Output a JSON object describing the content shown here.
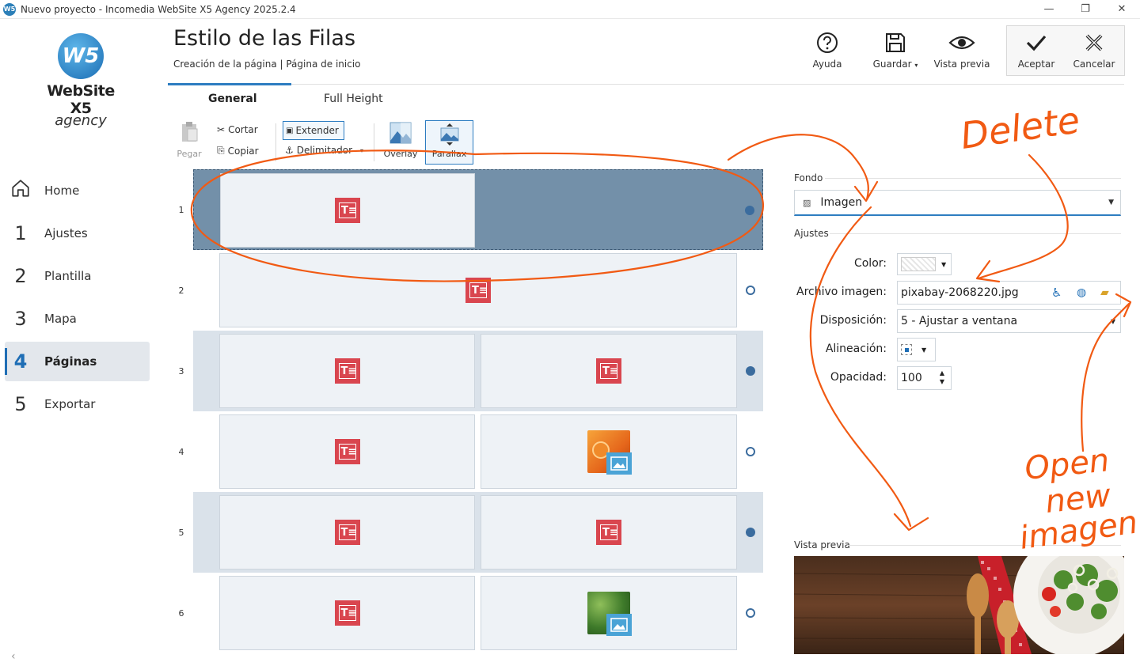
{
  "window": {
    "title": "Nuevo proyecto - Incomedia WebSite X5 Agency 2025.2.4",
    "minimize": "—",
    "maximize": "❐",
    "close": "✕"
  },
  "logo": {
    "line1": "WebSite X5",
    "line2": "agency",
    "mark": "W5"
  },
  "sidebar": {
    "items": [
      {
        "num": "",
        "label": "Home"
      },
      {
        "num": "1",
        "label": "Ajustes"
      },
      {
        "num": "2",
        "label": "Plantilla"
      },
      {
        "num": "3",
        "label": "Mapa"
      },
      {
        "num": "4",
        "label": "Páginas"
      },
      {
        "num": "5",
        "label": "Exportar"
      }
    ]
  },
  "header": {
    "title": "Estilo de las Filas",
    "subtitle": "Creación de la página | Página de inicio",
    "buttons": {
      "help": "Ayuda",
      "save": "Guardar",
      "preview": "Vista previa",
      "accept": "Aceptar",
      "cancel": "Cancelar"
    }
  },
  "tabs": [
    {
      "label": "General"
    },
    {
      "label": "Full Height"
    }
  ],
  "toolbar": {
    "paste": "Pegar",
    "cut": "Cortar",
    "copy": "Copiar",
    "extend": "Extender",
    "delimiter": "Delimitador",
    "overlay": "Overlay",
    "parallax": "Parallax"
  },
  "rows": [
    {
      "num": "1"
    },
    {
      "num": "2"
    },
    {
      "num": "3"
    },
    {
      "num": "4"
    },
    {
      "num": "5"
    },
    {
      "num": "6"
    }
  ],
  "panel": {
    "fondo_label": "Fondo",
    "fondo_value": "Imagen",
    "ajustes_label": "Ajustes",
    "color_label": "Color:",
    "archivo_label": "Archivo imagen:",
    "archivo_value": "pixabay-2068220.jpg",
    "disposicion_label": "Disposición:",
    "disposicion_value": "5 - Ajustar a ventana",
    "alineacion_label": "Alineación:",
    "opacidad_label": "Opacidad:",
    "opacidad_value": "100",
    "vista_previa_label": "Vista previa"
  },
  "annotations": {
    "delete": "Delete",
    "open1": "Open",
    "open2": "new",
    "open3": "imagen"
  },
  "colors": {
    "accent": "#2d7dc1",
    "selected_row": "#7390a9",
    "alt_row": "#dae2ea",
    "text_icon": "#d9464f",
    "image_badge": "#4aa3d6",
    "annotation": "#f15a13"
  }
}
